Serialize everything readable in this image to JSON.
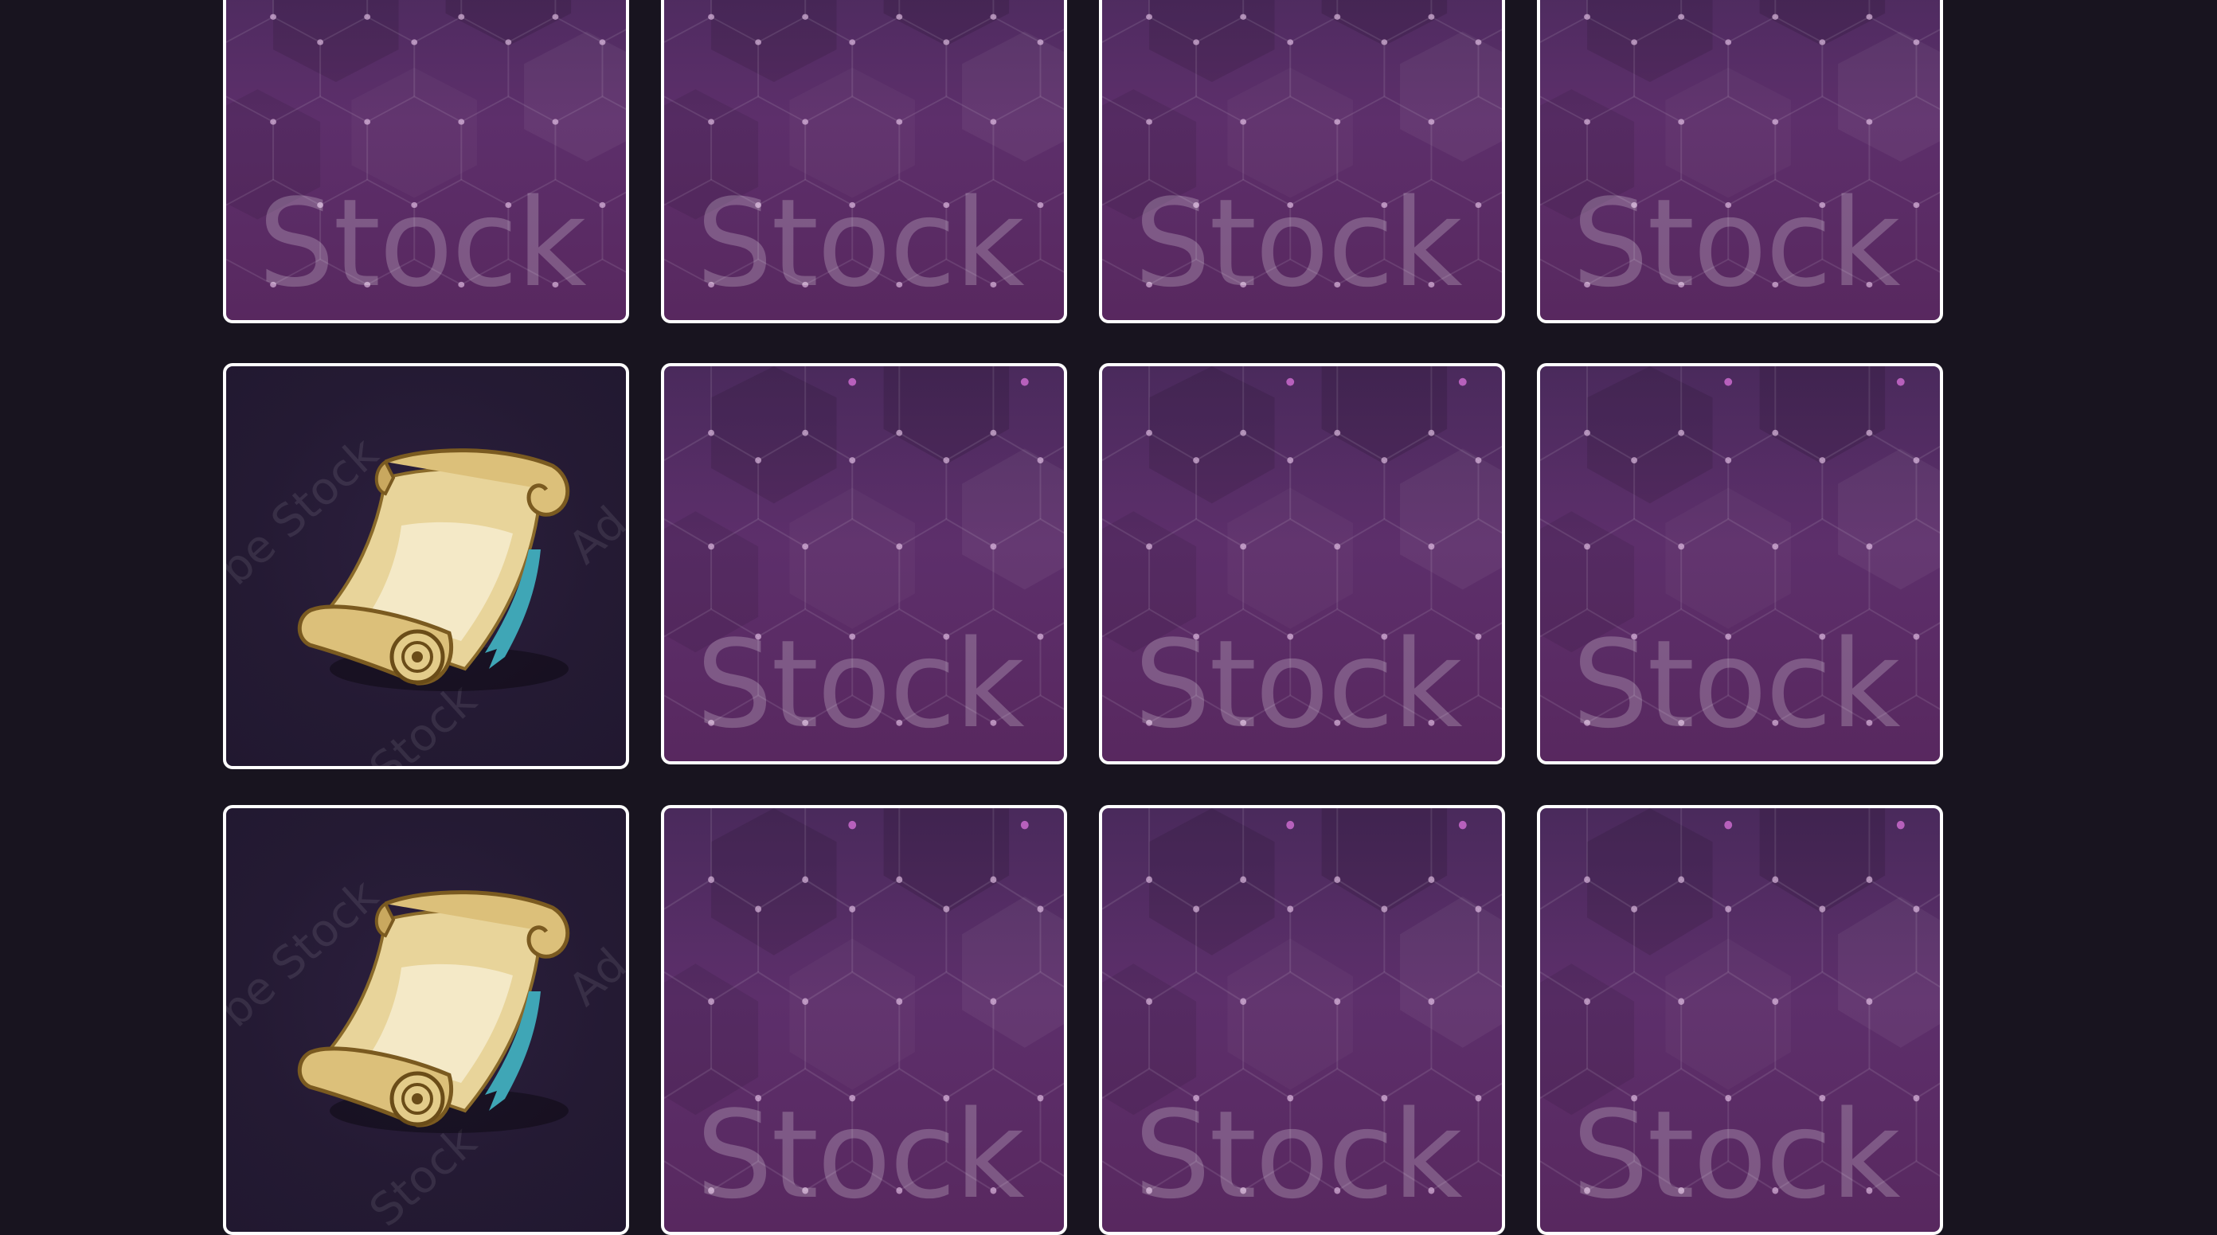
{
  "board": {
    "columns": 4,
    "rows": 3,
    "cards": [
      {
        "row": 1,
        "col": 1,
        "state": "face-down",
        "watermark": "Stock"
      },
      {
        "row": 1,
        "col": 2,
        "state": "face-down",
        "watermark": "Stock"
      },
      {
        "row": 1,
        "col": 3,
        "state": "face-down",
        "watermark": "Stock"
      },
      {
        "row": 1,
        "col": 4,
        "state": "face-down",
        "watermark": "Stock"
      },
      {
        "row": 2,
        "col": 1,
        "state": "face-up",
        "icon": "scroll-icon",
        "watermark_left": "be Stock",
        "watermark_right": "Ad",
        "watermark_bottom": "Stock"
      },
      {
        "row": 2,
        "col": 2,
        "state": "face-down",
        "watermark": "Stock"
      },
      {
        "row": 2,
        "col": 3,
        "state": "face-down",
        "watermark": "Stock"
      },
      {
        "row": 2,
        "col": 4,
        "state": "face-down",
        "watermark": "Stock"
      },
      {
        "row": 3,
        "col": 1,
        "state": "face-up",
        "icon": "scroll-icon",
        "watermark_left": "be Stock",
        "watermark_right": "Ad",
        "watermark_bottom": "Stock"
      },
      {
        "row": 3,
        "col": 2,
        "state": "face-down",
        "watermark": "Stock"
      },
      {
        "row": 3,
        "col": 3,
        "state": "face-down",
        "watermark": "Stock"
      },
      {
        "row": 3,
        "col": 4,
        "state": "face-down",
        "watermark": "Stock"
      }
    ]
  },
  "colors": {
    "background": "#18141f",
    "card_border": "#ffffff",
    "card_back": "#5d2f6b",
    "card_face": "#241a33",
    "scroll_parchment": "#e8d49a"
  }
}
